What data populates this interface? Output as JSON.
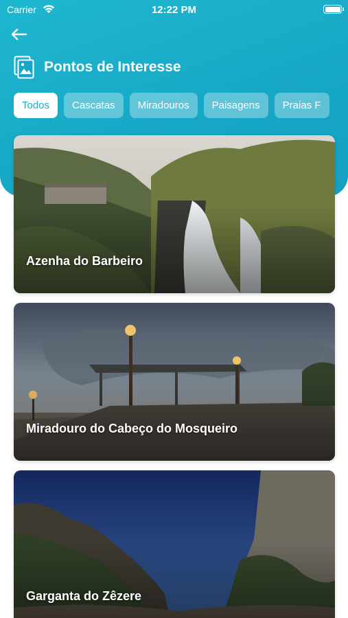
{
  "status_bar": {
    "carrier": "Carrier",
    "time": "12:22 PM"
  },
  "header": {
    "title": "Pontos de Interesse",
    "back_icon": "back-arrow-icon",
    "title_icon": "gallery-icon"
  },
  "filters": [
    {
      "label": "Todos",
      "active": true
    },
    {
      "label": "Cascatas",
      "active": false
    },
    {
      "label": "Miradouros",
      "active": false
    },
    {
      "label": "Paisagens",
      "active": false
    },
    {
      "label": "Praias F",
      "active": false
    }
  ],
  "places": [
    {
      "name": "Azenha do Barbeiro"
    },
    {
      "name": "Miradouro do Cabeço do Mosqueiro"
    },
    {
      "name": "Garganta do Zêzere"
    }
  ],
  "colors": {
    "brand": "#17a7c6",
    "chip_active_text": "#1aafc9"
  }
}
